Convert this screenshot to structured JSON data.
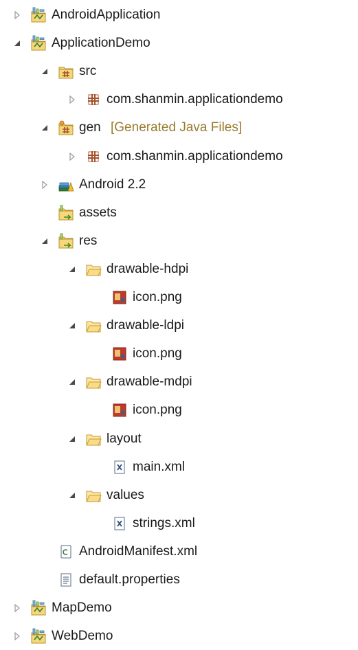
{
  "tree": {
    "rows": [
      {
        "label": "AndroidApplication",
        "depth": 0,
        "toggle": "collapsed",
        "icon": "android-project-icon"
      },
      {
        "label": "ApplicationDemo",
        "depth": 0,
        "toggle": "expanded",
        "icon": "android-project-icon"
      },
      {
        "label": "src",
        "depth": 1,
        "toggle": "expanded",
        "icon": "source-folder-icon"
      },
      {
        "label": "com.shanmin.applicationdemo",
        "depth": 2,
        "toggle": "collapsed",
        "icon": "package-icon"
      },
      {
        "label": "gen",
        "decoration": "[Generated Java Files]",
        "depth": 1,
        "toggle": "expanded",
        "icon": "generated-source-folder-icon"
      },
      {
        "label": "com.shanmin.applicationdemo",
        "depth": 2,
        "toggle": "collapsed",
        "icon": "package-icon"
      },
      {
        "label": "Android 2.2",
        "depth": 1,
        "toggle": "collapsed",
        "icon": "android-library-icon"
      },
      {
        "label": "assets",
        "depth": 1,
        "toggle": "none",
        "icon": "resource-folder-icon"
      },
      {
        "label": "res",
        "depth": 1,
        "toggle": "expanded",
        "icon": "resource-folder-icon"
      },
      {
        "label": "drawable-hdpi",
        "depth": 2,
        "toggle": "expanded",
        "icon": "folder-icon"
      },
      {
        "label": "icon.png",
        "depth": 3,
        "toggle": "none",
        "icon": "png-file-icon"
      },
      {
        "label": "drawable-ldpi",
        "depth": 2,
        "toggle": "expanded",
        "icon": "folder-icon"
      },
      {
        "label": "icon.png",
        "depth": 3,
        "toggle": "none",
        "icon": "png-file-icon"
      },
      {
        "label": "drawable-mdpi",
        "depth": 2,
        "toggle": "expanded",
        "icon": "folder-icon"
      },
      {
        "label": "icon.png",
        "depth": 3,
        "toggle": "none",
        "icon": "png-file-icon"
      },
      {
        "label": "layout",
        "depth": 2,
        "toggle": "expanded",
        "icon": "folder-icon"
      },
      {
        "label": "main.xml",
        "depth": 3,
        "toggle": "none",
        "icon": "xml-file-icon"
      },
      {
        "label": "values",
        "depth": 2,
        "toggle": "expanded",
        "icon": "folder-icon"
      },
      {
        "label": "strings.xml",
        "depth": 3,
        "toggle": "none",
        "icon": "xml-file-icon"
      },
      {
        "label": "AndroidManifest.xml",
        "depth": 1,
        "toggle": "none",
        "icon": "manifest-file-icon"
      },
      {
        "label": "default.properties",
        "depth": 1,
        "toggle": "none",
        "icon": "properties-file-icon"
      },
      {
        "label": "MapDemo",
        "depth": 0,
        "toggle": "collapsed",
        "icon": "android-project-icon"
      },
      {
        "label": "WebDemo",
        "depth": 0,
        "toggle": "collapsed",
        "icon": "android-project-icon"
      }
    ]
  }
}
